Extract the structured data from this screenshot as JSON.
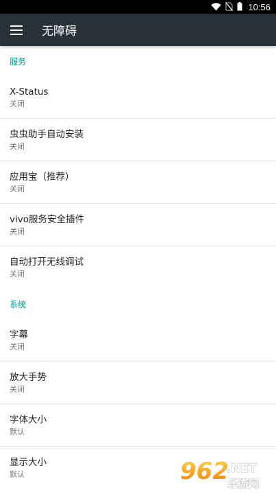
{
  "status_bar": {
    "time": "10:56",
    "icons": [
      "wifi-icon",
      "no-sim-icon",
      "battery-icon"
    ]
  },
  "app_bar": {
    "menu_icon": "menu-icon",
    "title": "无障碍",
    "background": "#263238"
  },
  "accent_color": "#009688",
  "sections": [
    {
      "header": "服务",
      "items": [
        {
          "title": "X-Status",
          "summary": "关闭"
        },
        {
          "title": "虫虫助手自动安装",
          "summary": "关闭"
        },
        {
          "title": "应用宝（推荐）",
          "summary": "关闭"
        },
        {
          "title": "vivo服务安全插件",
          "summary": "关闭"
        },
        {
          "title": "自动打开无线调试",
          "summary": "关闭"
        }
      ]
    },
    {
      "header": "系统",
      "items": [
        {
          "title": "字幕",
          "summary": "关闭"
        },
        {
          "title": "放大手势",
          "summary": "关闭"
        },
        {
          "title": "字体大小",
          "summary": "默认"
        },
        {
          "title": "显示大小",
          "summary": "默认"
        }
      ]
    }
  ],
  "watermark": {
    "brand": "962",
    "suffix": ".NET",
    "caption": "乐游网"
  }
}
